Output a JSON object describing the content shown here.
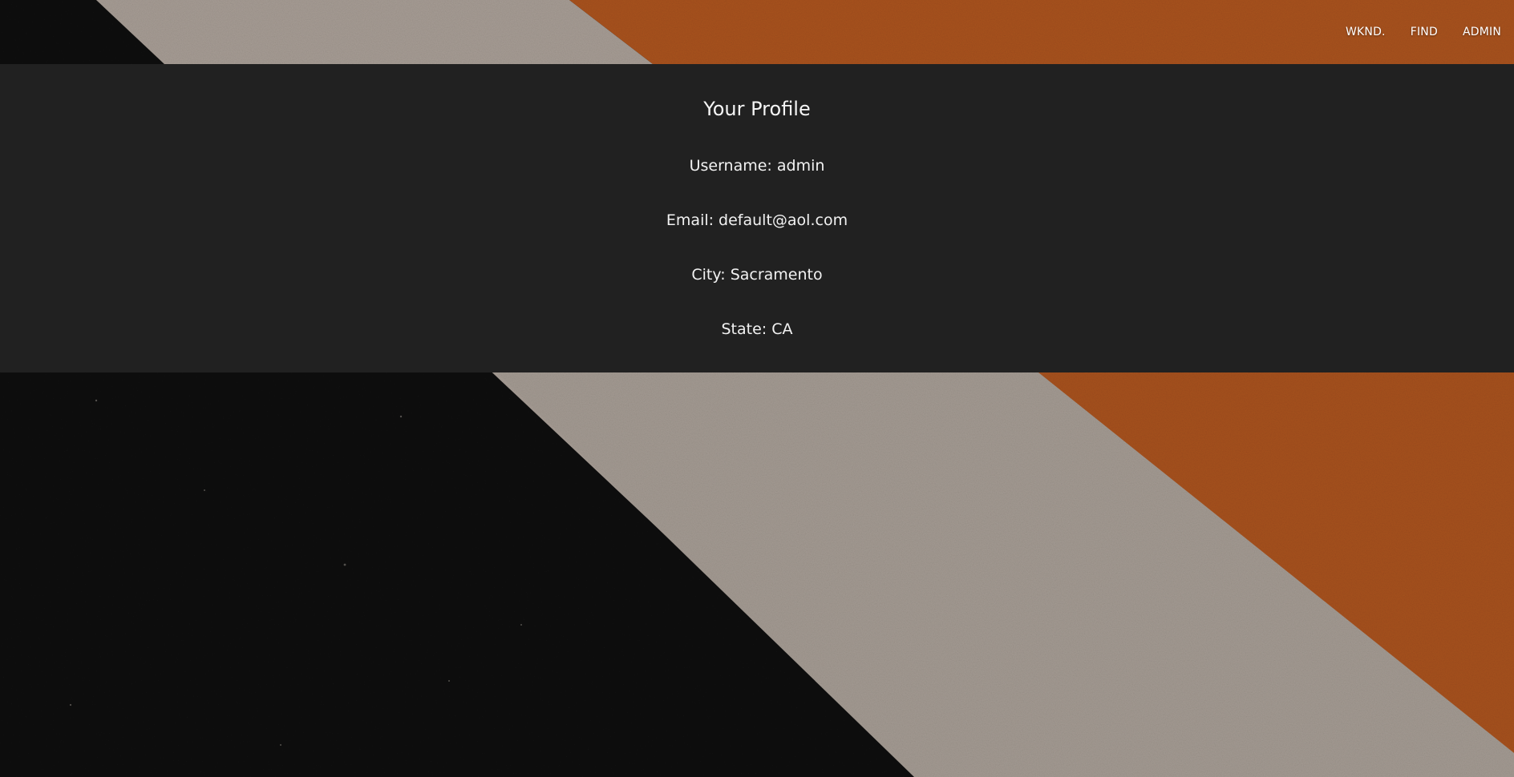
{
  "nav": {
    "items": [
      {
        "label": "WKND."
      },
      {
        "label": "FIND"
      },
      {
        "label": "ADMIN"
      }
    ]
  },
  "profile": {
    "title": "Your Profile",
    "username": "Username: admin",
    "email": "Email: default@aol.com",
    "city": "City: Sacramento",
    "state": "State: CA"
  },
  "colors": {
    "panel": "#212121",
    "stripe_black": "#111111",
    "stripe_grey": "#a59b93",
    "stripe_orange": "#a9531f"
  }
}
